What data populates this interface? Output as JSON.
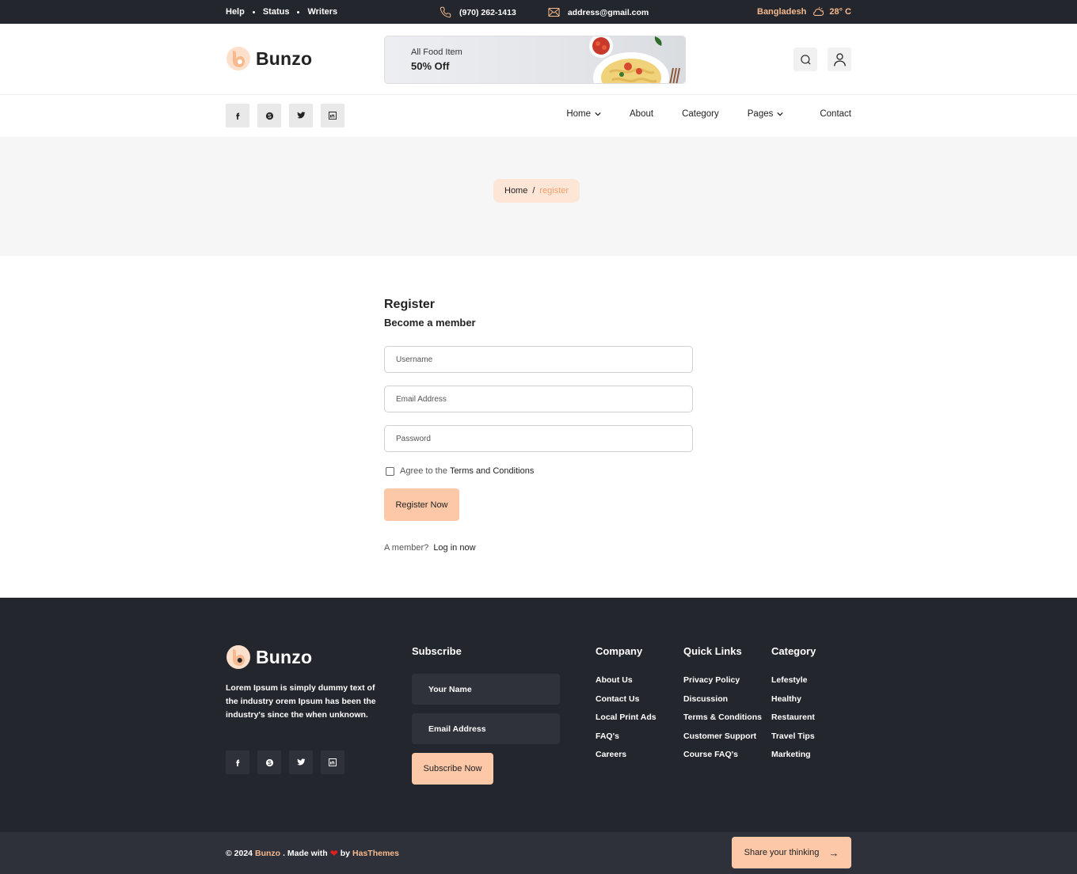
{
  "topbar": {
    "links": [
      "Help",
      "Status",
      "Writers"
    ],
    "phone": "(970) 262-1413",
    "email": "address@gmail.com",
    "location": "Bangladesh",
    "temperature": "28° C"
  },
  "brand": {
    "name": "Bunzo",
    "accent": "#f7b98d"
  },
  "banner": {
    "line1": "All Food Item",
    "line2": "50% Off"
  },
  "nav": {
    "items": [
      {
        "label": "Home",
        "dropdown": true
      },
      {
        "label": "About",
        "dropdown": false
      },
      {
        "label": "Category",
        "dropdown": false
      },
      {
        "label": "Pages",
        "dropdown": true
      },
      {
        "label": "Contact",
        "dropdown": false
      }
    ],
    "social_icons": [
      "facebook-icon",
      "skype-icon",
      "twitter-icon",
      "linkedin-icon"
    ]
  },
  "breadcrumb": {
    "home": "Home",
    "separator": "/",
    "current": "register"
  },
  "register": {
    "title": "Register",
    "subtitle": "Become a member",
    "username_placeholder": "Username",
    "email_placeholder": "Email Address",
    "password_placeholder": "Password",
    "agree_text": "Agree to the",
    "terms_text": "Terms and Conditions",
    "submit_label": "Register Now",
    "member_text": "A member?",
    "login_text": "Log in now"
  },
  "footer": {
    "about": "Lorem Ipsum is simply dummy text of the industry orem Ipsum has been the industry's since the when unknown.",
    "subscribe": {
      "title": "Subscribe",
      "name_placeholder": "Your Name",
      "email_placeholder": "Email Address",
      "button": "Subscribe Now"
    },
    "company": {
      "title": "Company",
      "items": [
        "About Us",
        "Contact Us",
        "Local Print Ads",
        "FAQ's",
        "Careers"
      ]
    },
    "quick_links": {
      "title": "Quick Links",
      "items": [
        "Privacy Policy",
        "Discussion",
        "Terms & Conditions",
        "Customer Support",
        "Course FAQ's"
      ]
    },
    "category": {
      "title": "Category",
      "items": [
        "Lefestyle",
        "Healthy",
        "Restaurent",
        "Travel Tips",
        "Marketing"
      ]
    }
  },
  "bottom": {
    "copyright": "© 2024",
    "brand": "Bunzo",
    "made_with": ". Made with",
    "by": "by",
    "author": "HasThemes",
    "share_label": "Share your thinking"
  }
}
